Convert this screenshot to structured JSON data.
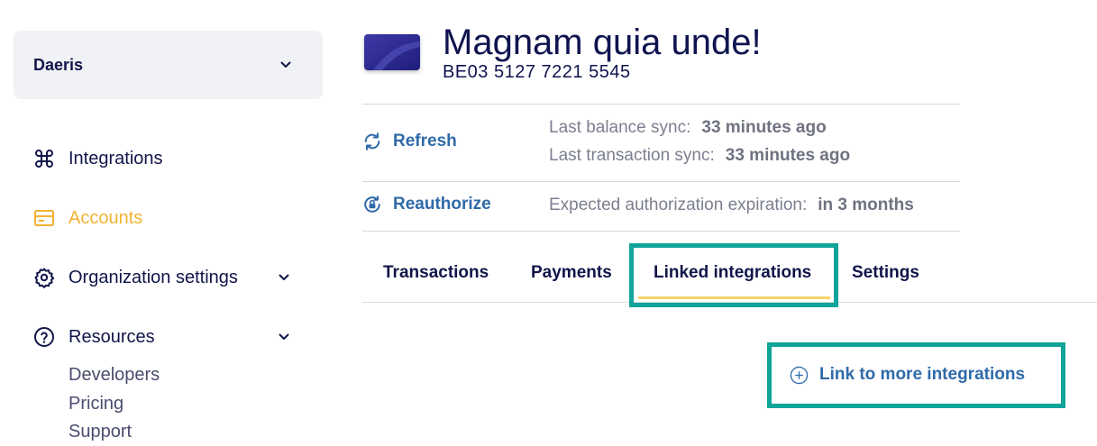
{
  "sidebar": {
    "org_name": "Daeris",
    "items": [
      {
        "label": "Integrations"
      },
      {
        "label": "Accounts"
      },
      {
        "label": "Organization settings"
      },
      {
        "label": "Resources"
      }
    ],
    "resources_links": [
      "Developers",
      "Pricing",
      "Support"
    ],
    "active_color": "#f2b233"
  },
  "account": {
    "name": "Magnam quia unde!",
    "iban": "BE03 5127 7221 5545"
  },
  "actions": {
    "refresh_label": "Refresh",
    "reauthorize_label": "Reauthorize"
  },
  "sync": {
    "balance_label": "Last balance sync:",
    "balance_value": "33 minutes ago",
    "transaction_label": "Last transaction sync:",
    "transaction_value": "33 minutes ago",
    "expiration_label": "Expected authorization expiration:",
    "expiration_value": "in 3 months"
  },
  "tabs": [
    {
      "label": "Transactions"
    },
    {
      "label": "Payments"
    },
    {
      "label": "Linked integrations",
      "active": true
    },
    {
      "label": "Settings"
    }
  ],
  "linked": {
    "link_more_label": "Link to more integrations"
  },
  "colors": {
    "link_blue": "#2f6aa8",
    "highlight_teal": "#10a49a",
    "navy": "#11154a"
  }
}
